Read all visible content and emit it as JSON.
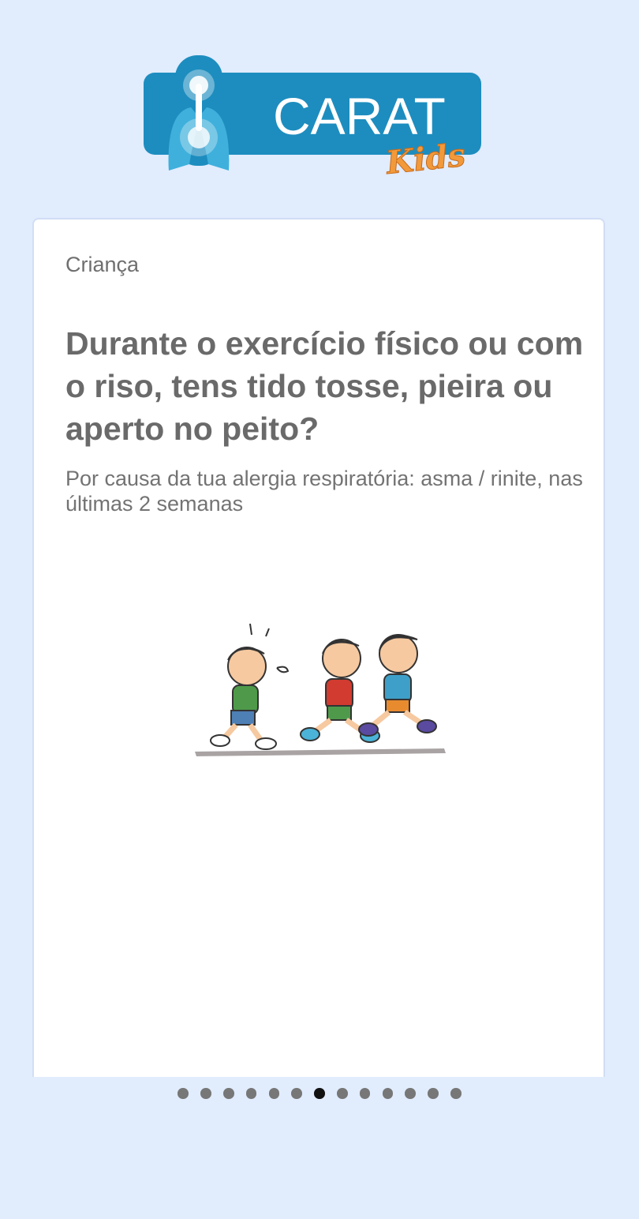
{
  "logo": {
    "word": "CARAT",
    "sub": "Kids",
    "icon": "lungs-icon"
  },
  "card": {
    "label": "Criança",
    "question": "Durante o exercício físico ou com o riso, tens tido tosse, pieira ou aperto no peito?",
    "subtitle": "Por causa da tua alergia respiratória: asma / rinite, nas últimas 2 semanas",
    "illustration": "children-running-illustration"
  },
  "pager": {
    "total": 13,
    "active_index": 6
  },
  "colors": {
    "background": "#e1ecfd",
    "logo_blue": "#1d8dbf",
    "logo_orange": "#f29a3a",
    "dot_active": "#111111",
    "dot_inactive": "#777777"
  }
}
